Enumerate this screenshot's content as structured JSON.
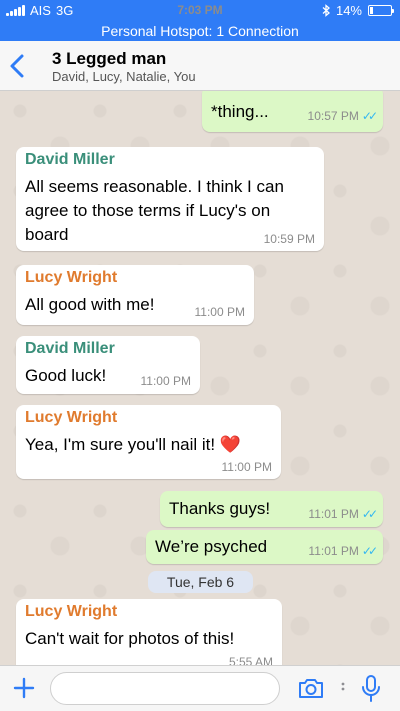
{
  "status_bar": {
    "carrier": "AIS",
    "network": "3G",
    "time": "7:03 PM",
    "bluetooth_icon": "bluetooth-icon",
    "battery_percent": "14%",
    "battery_level": 0.14
  },
  "hotspot_banner": "Personal Hotspot: 1 Connection",
  "header": {
    "title": "3 Legged man",
    "subtitle": "David, Lucy, Natalie, You"
  },
  "colors": {
    "accent": "#2f7cf6",
    "outgoing_bubble": "#dcf8c6",
    "incoming_bubble": "#ffffff",
    "david_name": "#3a8f7a",
    "lucy_name": "#e07b2e",
    "read_ticks": "#34b7f1"
  },
  "messages": [
    {
      "direction": "out",
      "text": "*thing...",
      "time": "10:57 PM",
      "ticks": "✓✓"
    },
    {
      "direction": "in",
      "sender": "David Miller",
      "lines": [
        "All seems reasonable. I think I can",
        "agree to those terms if Lucy's on",
        "board"
      ],
      "time": "10:59 PM"
    },
    {
      "direction": "in",
      "sender": "Lucy Wright",
      "text": "All good with me!",
      "time": "11:00 PM"
    },
    {
      "direction": "in",
      "sender": "David Miller",
      "text": "Good luck!",
      "time": "11:00 PM"
    },
    {
      "direction": "in",
      "sender": "Lucy Wright",
      "text": "Yea, I'm sure you'll nail it! ❤️",
      "time": "11:00 PM"
    },
    {
      "direction": "out",
      "text": "Thanks guys!",
      "time": "11:01 PM",
      "ticks": "✓✓"
    },
    {
      "direction": "out",
      "text": "We’re psyched",
      "time": "11:01 PM",
      "ticks": "✓✓"
    },
    {
      "direction": "in",
      "sender": "Lucy Wright",
      "text": "Can't wait for photos of this!",
      "time": "5:55 AM"
    }
  ],
  "date_separator": "Tue, Feb 6",
  "composer": {
    "placeholder": "",
    "value": ""
  }
}
